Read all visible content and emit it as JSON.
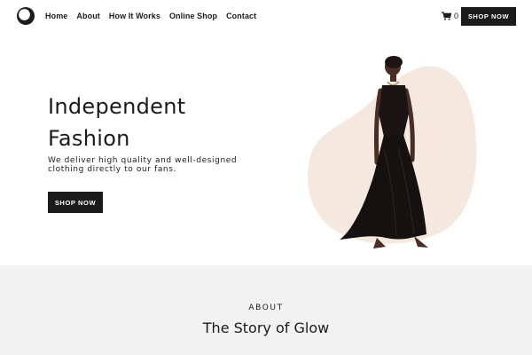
{
  "header": {
    "logo_icon": "circle-logo-icon",
    "nav": [
      {
        "label": "Home"
      },
      {
        "label": "About"
      },
      {
        "label": "How It Works"
      },
      {
        "label": "Online Shop"
      },
      {
        "label": "Contact"
      }
    ],
    "cart_icon": "cart-icon",
    "cart_count": "0",
    "shop_button": "SHOP NOW"
  },
  "hero": {
    "title": "Independent Fashion",
    "subtitle": "We deliver high quality and well-designed clothing directly to our fans.",
    "button": "SHOP NOW",
    "image": "model-in-black-gown-image",
    "blob_color": "#f5e9df"
  },
  "about": {
    "label": "ABOUT",
    "title": "The Story of Glow",
    "background": "#f2f2f2"
  },
  "colors": {
    "accent_dark": "#1b1b1b",
    "page_bg": "#ffffff"
  }
}
